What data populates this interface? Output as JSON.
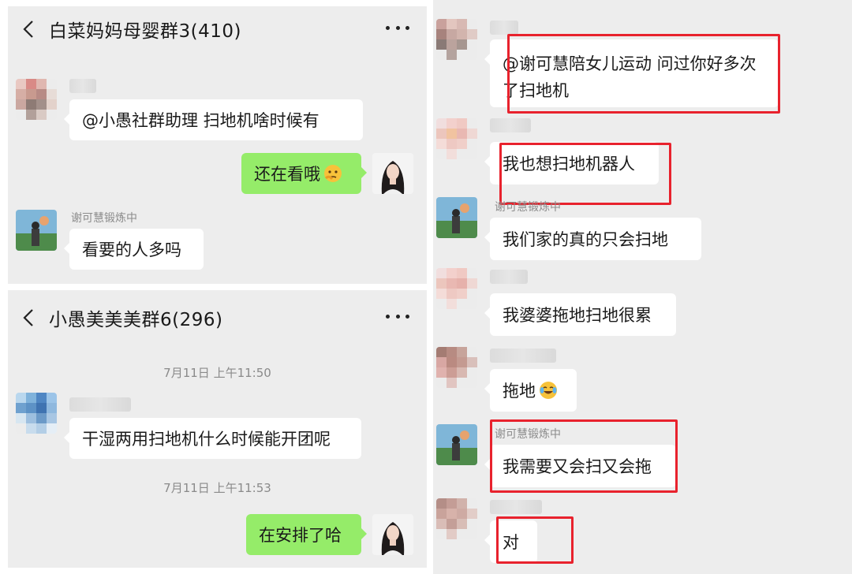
{
  "top_chat": {
    "title": "白菜妈妈母婴群3(410)",
    "messages": {
      "m1": "@小愚社群助理  扫地机啥时候有",
      "m2": "还在看哦",
      "m3_sender": "谢可慧锻炼中",
      "m3": "看要的人多吗"
    }
  },
  "bottom_chat": {
    "title": "小愚美美美群6(296)",
    "time1": "7月11日 上午11:50",
    "m1": "干湿两用扫地机什么时候能开团呢",
    "time2": "7月11日 上午11:53",
    "m2": "在安排了哈"
  },
  "right_chat": {
    "m1": "@谢可慧陪女儿运动  问过你好多次了扫地机",
    "m2": "我也想扫地机器人",
    "m3_sender": "谢可慧锻炼中",
    "m3": "我们家的真的只会扫地",
    "m4": "我婆婆拖地扫地很累",
    "m5": "拖地",
    "m6_sender": "谢可慧锻炼中",
    "m6": "我需要又会扫又会拖",
    "m7": "对"
  },
  "colors": {
    "highlight": "#e8222d",
    "bubble_green": "#95ec69",
    "chat_bg": "#ededed"
  },
  "icons": [
    "back-icon",
    "more-icon",
    "emoji-thinking",
    "emoji-laugh-cry"
  ]
}
